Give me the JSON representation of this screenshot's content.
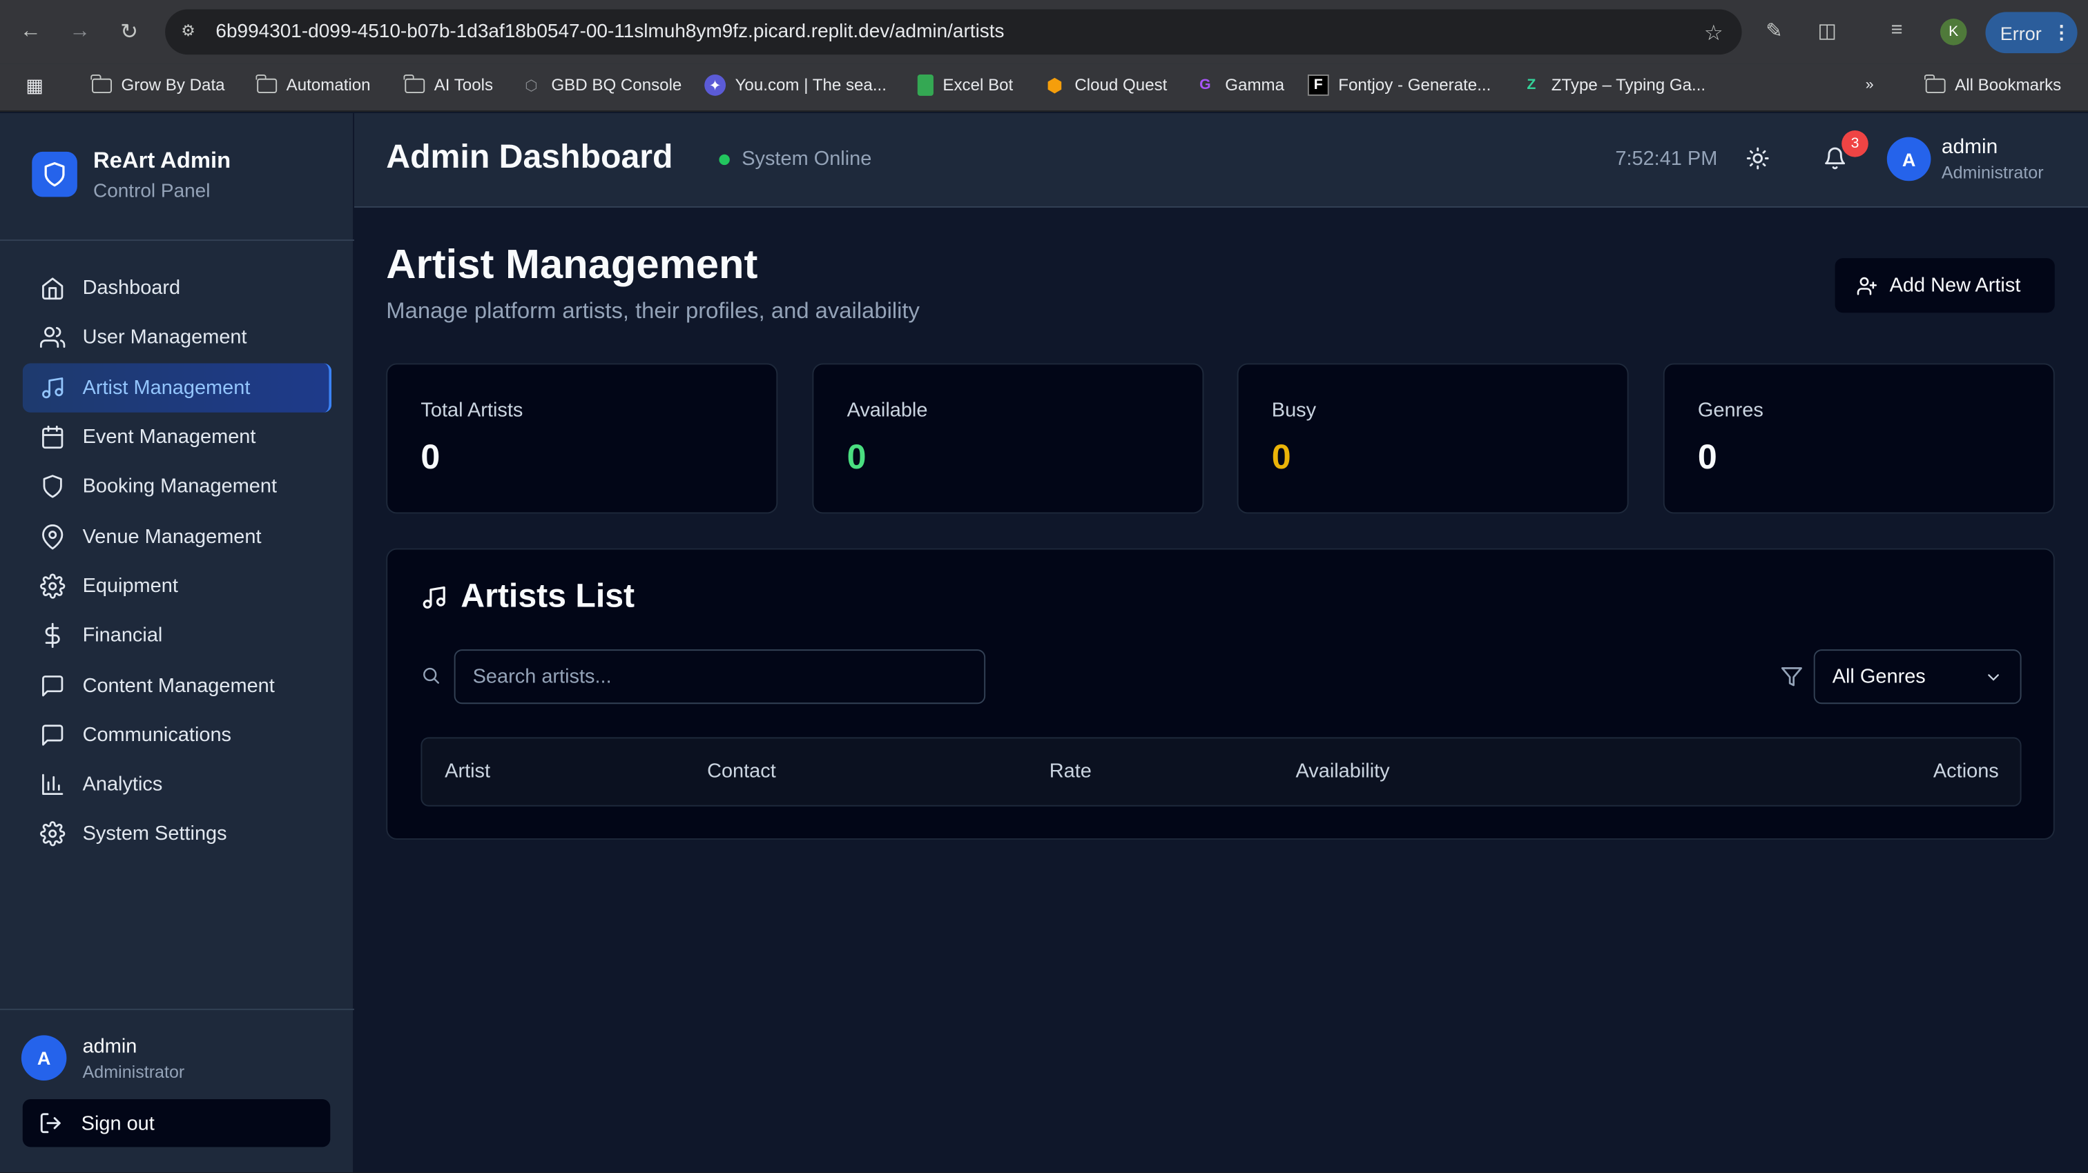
{
  "browser": {
    "url": "6b994301-d099-4510-b07b-1d3af18b0547-00-11slmuh8ym9fz.picard.replit.dev/admin/artists",
    "profile_initial": "K",
    "error_label": "Error",
    "bookmarks": [
      {
        "label": "Grow By Data",
        "icon": "folder-icon"
      },
      {
        "label": "Automation",
        "icon": "folder-icon"
      },
      {
        "label": "AI Tools",
        "icon": "folder-icon"
      },
      {
        "label": "GBD BQ Console",
        "icon": "bigquery-icon"
      },
      {
        "label": "You.com | The sea...",
        "icon": "youcom-icon"
      },
      {
        "label": "Excel Bot",
        "icon": "sheets-icon"
      },
      {
        "label": "Cloud Quest",
        "icon": "cube-icon"
      },
      {
        "label": "Gamma",
        "icon": "gamma-icon"
      },
      {
        "label": "Fontjoy - Generate...",
        "icon": "fontjoy-icon"
      },
      {
        "label": "ZType – Typing Ga...",
        "icon": "ztype-icon"
      }
    ],
    "all_bookmarks": "All Bookmarks"
  },
  "brand": {
    "title": "ReArt Admin",
    "subtitle": "Control Panel"
  },
  "sidebar": {
    "items": [
      {
        "label": "Dashboard",
        "icon": "home-icon"
      },
      {
        "label": "User Management",
        "icon": "users-icon"
      },
      {
        "label": "Artist Management",
        "icon": "music-icon",
        "active": true
      },
      {
        "label": "Event Management",
        "icon": "calendar-icon"
      },
      {
        "label": "Booking Management",
        "icon": "shield-icon"
      },
      {
        "label": "Venue Management",
        "icon": "map-pin-icon"
      },
      {
        "label": "Equipment",
        "icon": "gear-icon"
      },
      {
        "label": "Financial",
        "icon": "dollar-icon"
      },
      {
        "label": "Content Management",
        "icon": "message-icon"
      },
      {
        "label": "Communications",
        "icon": "message-icon"
      },
      {
        "label": "Analytics",
        "icon": "bar-chart-icon"
      },
      {
        "label": "System Settings",
        "icon": "gear-icon"
      }
    ],
    "user": {
      "initial": "A",
      "name": "admin",
      "role": "Administrator"
    },
    "signout": "Sign out"
  },
  "header": {
    "title": "Admin Dashboard",
    "status": "System Online",
    "time": "7:52:41 PM",
    "notifications": "3",
    "user": {
      "initial": "A",
      "name": "admin",
      "role": "Administrator"
    }
  },
  "page": {
    "title": "Artist Management",
    "subtitle": "Manage platform artists, their profiles, and availability",
    "add_button": "Add New Artist"
  },
  "stats": [
    {
      "label": "Total Artists",
      "value": "0",
      "color": "#f8fafc"
    },
    {
      "label": "Available",
      "value": "0",
      "color": "#4ade80"
    },
    {
      "label": "Busy",
      "value": "0",
      "color": "#eab308"
    },
    {
      "label": "Genres",
      "value": "0",
      "color": "#f8fafc"
    }
  ],
  "artists_list": {
    "title": "Artists List",
    "search_placeholder": "Search artists...",
    "genre_filter": "All Genres",
    "columns": [
      "Artist",
      "Contact",
      "Rate",
      "Availability",
      "Actions"
    ]
  },
  "colors": {
    "accent": "#2563eb",
    "online": "#22c55e",
    "badge": "#ef4444"
  }
}
